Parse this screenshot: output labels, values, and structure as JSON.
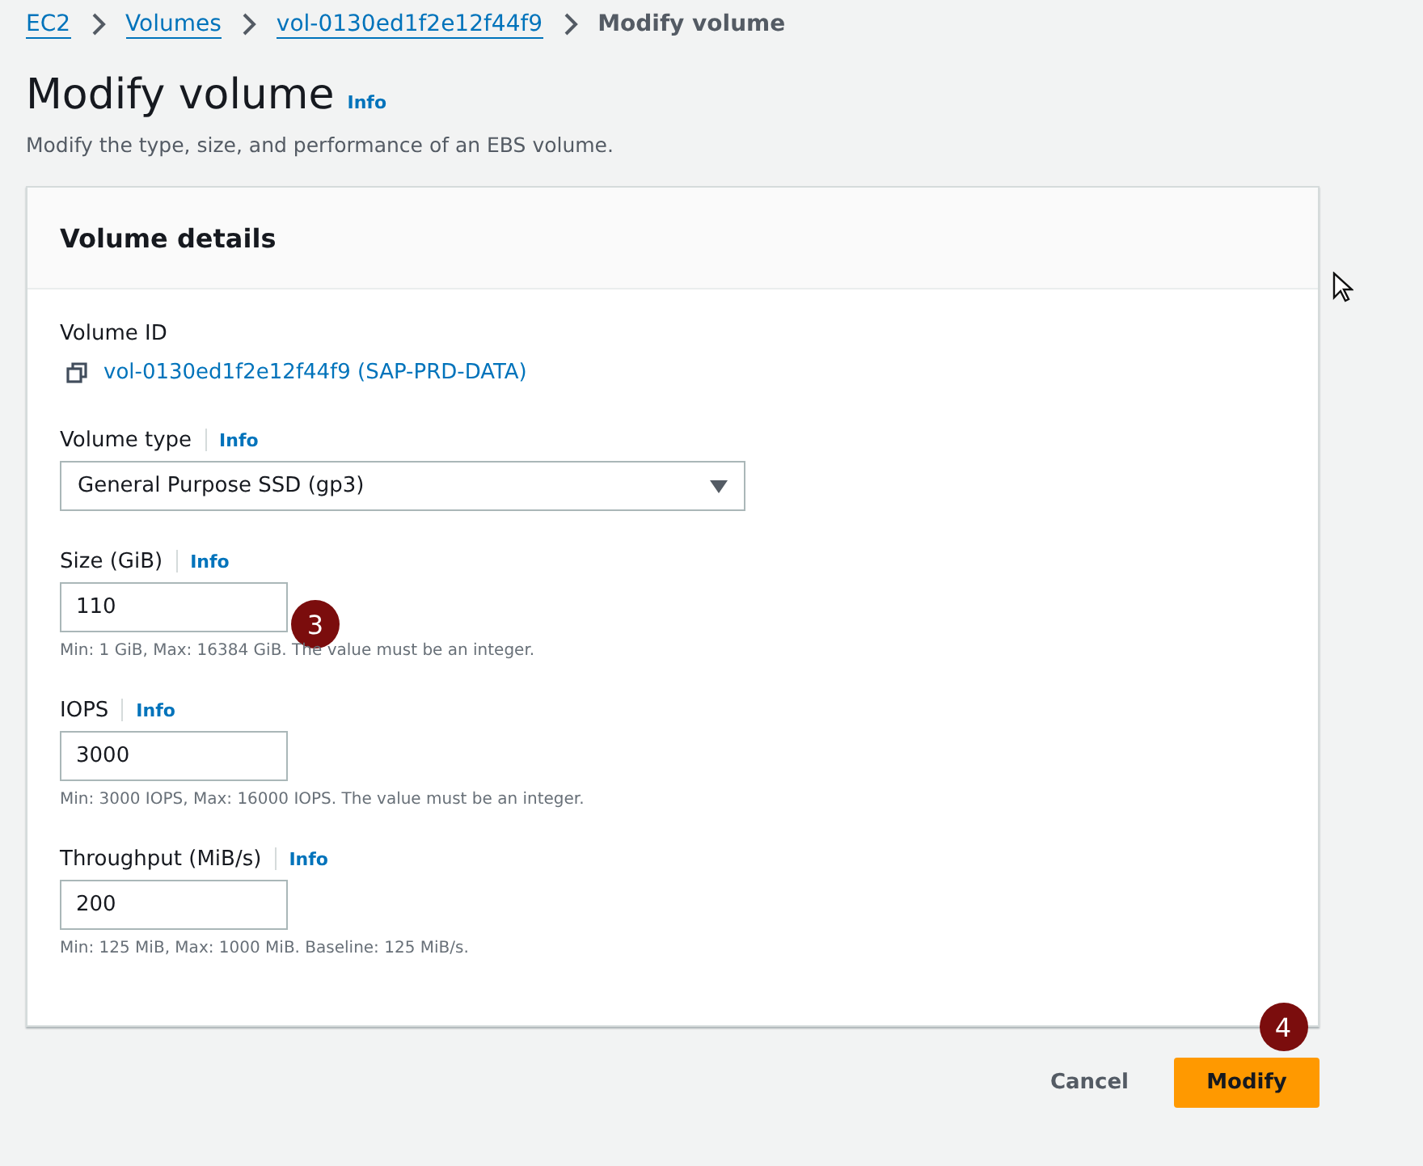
{
  "breadcrumbs": [
    {
      "label": "EC2",
      "link": true
    },
    {
      "label": "Volumes",
      "link": true
    },
    {
      "label": "vol-0130ed1f2e12f44f9",
      "link": true
    },
    {
      "label": "Modify volume",
      "link": false
    }
  ],
  "page": {
    "title": "Modify volume",
    "info": "Info",
    "description": "Modify the type, size, and performance of an EBS volume."
  },
  "panel": {
    "title": "Volume details",
    "fields": [
      {
        "kind": "copy",
        "label": "Volume ID",
        "value": "vol-0130ed1f2e12f44f9 (SAP-PRD-DATA)"
      },
      {
        "kind": "select",
        "label": "Volume type",
        "info": "Info",
        "value": "General Purpose SSD (gp3)"
      },
      {
        "kind": "input",
        "label": "Size (GiB)",
        "info": "Info",
        "value": "110",
        "hint": "Min: 1 GiB, Max: 16384 GiB. The value must be an integer.",
        "step": "3"
      },
      {
        "kind": "input",
        "label": "IOPS",
        "info": "Info",
        "value": "3000",
        "hint": "Min: 3000 IOPS, Max: 16000 IOPS. The value must be an integer."
      },
      {
        "kind": "input",
        "label": "Throughput (MiB/s)",
        "info": "Info",
        "value": "200",
        "hint": "Min: 125 MiB, Max: 1000 MiB. Baseline: 125 MiB/s."
      }
    ]
  },
  "actions": {
    "cancel": "Cancel",
    "submit": "Modify",
    "submit_step": "4"
  }
}
